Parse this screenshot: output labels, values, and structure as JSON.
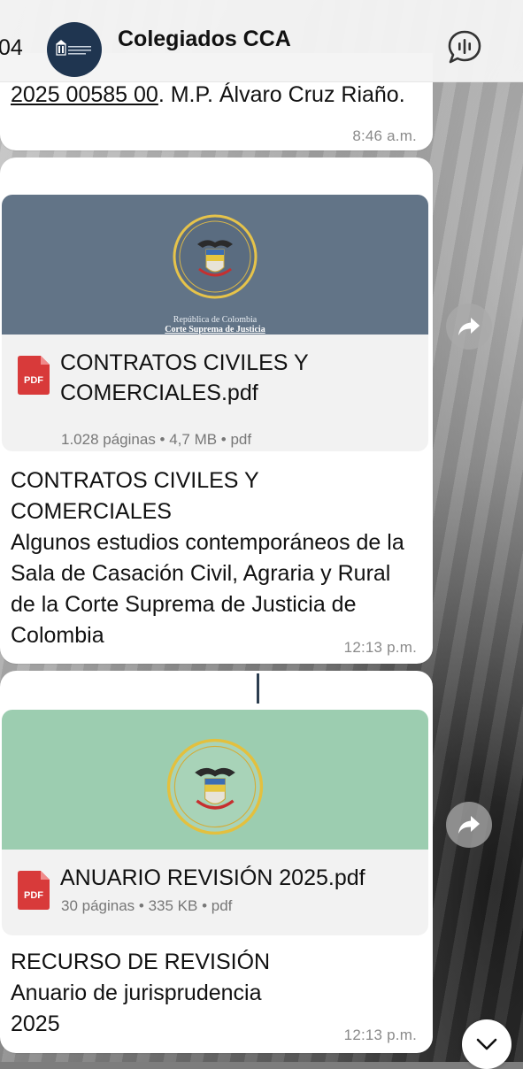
{
  "header": {
    "back_count": "04",
    "title": "Colegiados CCA",
    "avatar_icon": "institution-logo",
    "voice_icon": "voice-chat-icon"
  },
  "messages": [
    {
      "link_text": "2025 00585 00",
      "text_after_link": ". M.P. Álvaro Cruz Riaño.",
      "time": "8:46 a.m."
    },
    {
      "document": {
        "preview_line1": "República de Colombia",
        "preview_line2": "Corte Suprema de Justicia",
        "icon_label": "PDF",
        "file_name": "CONTRATOS CIVILES Y COMERCIALES.pdf",
        "meta": "1.028 páginas • 4,7 MB • pdf"
      },
      "caption": "CONTRATOS CIVILES Y COMERCIALES\nAlgunos estudios contemporáneos de la Sala de Casación Civil, Agraria y Rural de la Corte Suprema de Justicia de Colombia",
      "time": "12:13 p.m."
    },
    {
      "document": {
        "icon_label": "PDF",
        "file_name": "ANUARIO REVISIÓN 2025.pdf",
        "meta": "30 páginas • 335 KB • pdf"
      },
      "caption": "RECURSO DE REVISIÓN\nAnuario de jurisprudencia\n2025",
      "time": "12:13 p.m."
    }
  ],
  "colors": {
    "header_bg": "#f4f4f4",
    "avatar_bg": "#1f3550",
    "preview1_bg": "#627487",
    "preview2_bg": "#9ccdb0",
    "pdf_red": "#d83a3a"
  }
}
